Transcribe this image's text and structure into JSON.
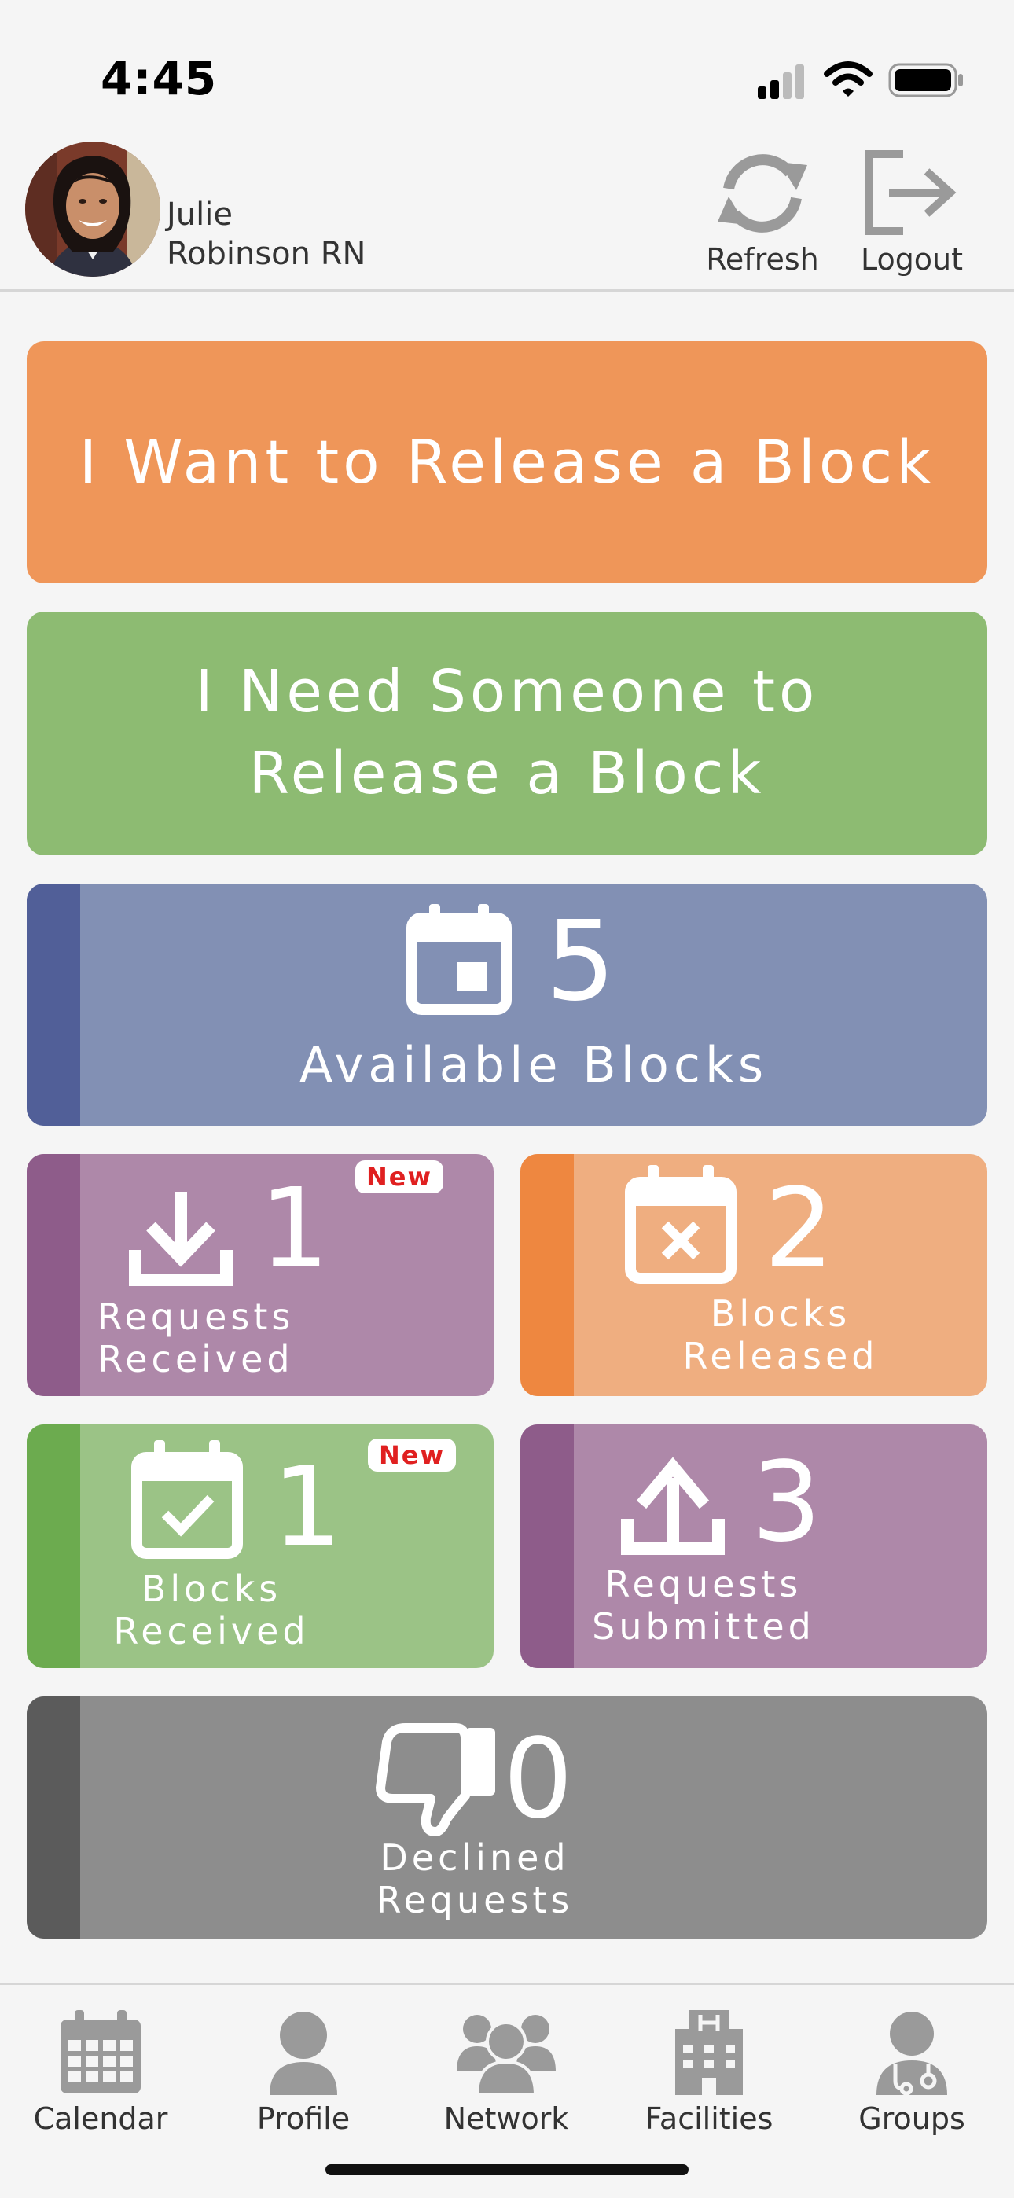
{
  "status": {
    "time": "4:45"
  },
  "user": {
    "first": "Julie",
    "last": "Robinson RN"
  },
  "header": {
    "refresh_label": "Refresh",
    "logout_label": "Logout"
  },
  "actions": {
    "release": "I Want to Release a Block",
    "need_line1": "I Need Someone to",
    "need_line2": "Release a Block"
  },
  "tiles": {
    "available": {
      "count": "5",
      "label": "Available Blocks"
    },
    "requests_received": {
      "count": "1",
      "line1": "Requests",
      "line2": "Received",
      "badge": "New"
    },
    "blocks_released": {
      "count": "2",
      "line1": "Blocks",
      "line2": "Released"
    },
    "blocks_received": {
      "count": "1",
      "line1": "Blocks",
      "line2": "Received",
      "badge": "New"
    },
    "requests_submitted": {
      "count": "3",
      "line1": "Requests",
      "line2": "Submitted"
    },
    "declined": {
      "count": "0",
      "line1": "Declined",
      "line2": "Requests"
    }
  },
  "nav": {
    "calendar": "Calendar",
    "profile": "Profile",
    "network": "Network",
    "facilities": "Facilities",
    "groups": "Groups"
  },
  "colors": {
    "orange": "#ef9659",
    "green": "#8dbb72",
    "blue": "#8290b4",
    "blue_dark": "#515f98",
    "purple": "#ae88a9",
    "purple_dark": "#8e5c8a",
    "peach": "#efae80",
    "peach_dark": "#ee8740",
    "green2": "#9bc386",
    "green2_dark": "#6cab4f",
    "gray": "#8d8d8d",
    "gray_dark": "#5b5b5b"
  }
}
